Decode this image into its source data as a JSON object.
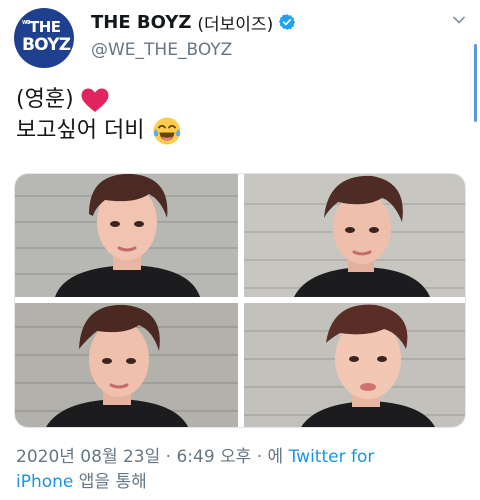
{
  "header": {
    "avatar_logo_small": "WE",
    "avatar_logo_top": "THE",
    "avatar_logo_bottom": "BOYZ",
    "display_name": "THE BOYZ",
    "display_name_ko": "(더보이즈)",
    "handle": "@WE_THE_BOYZ",
    "icons": [
      "verified-icon",
      "chevron-down-icon"
    ]
  },
  "tweet": {
    "line1": "(영훈)",
    "line2": "보고싶어 더비",
    "emojis": [
      "heart-icon",
      "laugh-icon"
    ]
  },
  "media": {
    "count": 4
  },
  "meta": {
    "timestamp": "2020년 08월 23일 · 6:49 오후 · 에",
    "source_part1": "Twitter for",
    "source_part2": "iPhone",
    "suffix": "앱을 통해"
  },
  "colors": {
    "accent": "#1b95e0",
    "secondary_text": "#657786",
    "heart": "#e0245e",
    "avatar_bg": "#1f3f8f"
  }
}
